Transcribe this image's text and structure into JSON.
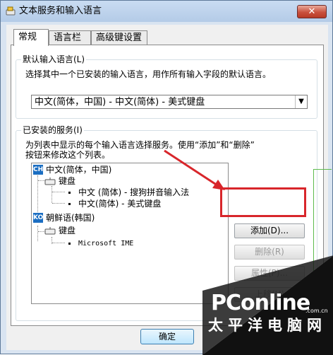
{
  "window": {
    "title": "文本服务和输入语言",
    "close_label": "✕"
  },
  "tabs": [
    {
      "label": "常规",
      "active": true
    },
    {
      "label": "语言栏",
      "active": false
    },
    {
      "label": "高级键设置",
      "active": false
    }
  ],
  "default_lang": {
    "legend": "默认输入语言(L)",
    "description": "选择其中一个已安装的输入语言，用作所有输入字段的默认语言。",
    "selected": "中文(简体，中国) - 中文(简体) - 美式键盘"
  },
  "services": {
    "legend": "已安装的服务(I)",
    "description_line1": "为列表中显示的每个输入语言选择服务。使用“添加”和“删除”",
    "description_line2": "按钮来修改这个列表。",
    "tree": [
      {
        "icon": "CH",
        "label": "中文(简体，中国)"
      },
      {
        "label": "键盘"
      },
      {
        "label": "中文 (简体) - 搜狗拼音输入法"
      },
      {
        "label": "中文(简体) - 美式键盘"
      },
      {
        "icon": "KO",
        "label": "朝鲜语(韩国)"
      },
      {
        "label": "键盘"
      },
      {
        "label": "Microsoft IME"
      }
    ]
  },
  "buttons": {
    "add": "添加(D)...",
    "remove": "删除(R)",
    "properties": "属性(P)...",
    "move_up": "上移(U)"
  },
  "footer": {
    "ok": "确定"
  },
  "watermark": {
    "logo": "PConline",
    "domain": ".com.cn",
    "cn": "太平洋电脑网"
  },
  "colors": {
    "highlight": "#d8262b",
    "accent": "#1b6ec2"
  }
}
